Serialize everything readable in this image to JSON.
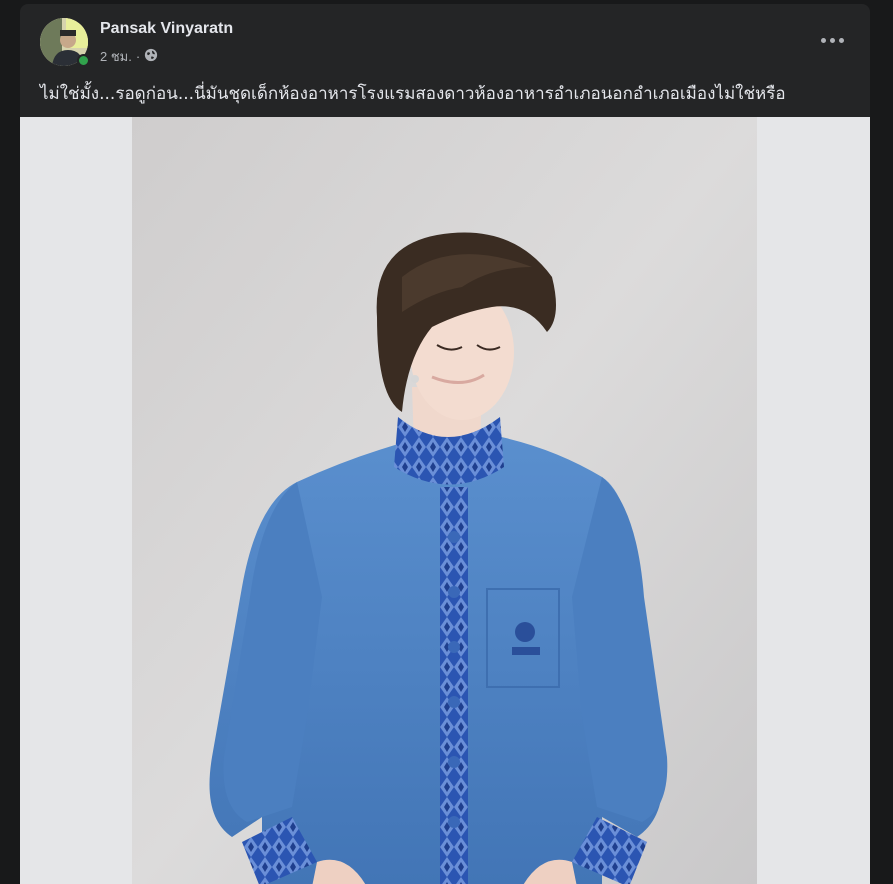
{
  "post": {
    "author": "Pansak Vinyaratn",
    "time": "2 ชม.",
    "dot": "·",
    "audience_icon": "globe-icon",
    "caption": "ไม่ใช่มั้ง...รอดูก่อน...นี่มันชุดเด็กห้องอาหารโรงแรมสองดาวห้องอาหารอำเภอนอกอำเภอเมืองไม่ใช่หรือ",
    "more_icon": "more-options-icon"
  },
  "colors": {
    "background": "#18191a",
    "card": "#242526",
    "text_primary": "#e4e6eb",
    "text_secondary": "#b0b3b8",
    "online": "#31a24c",
    "media_backdrop": "#e5e6e8",
    "jacket": "#4f83c4",
    "trim": "#2c55b0"
  },
  "media": {
    "image_type": "photo",
    "subject": "person-in-blue-jacket"
  }
}
